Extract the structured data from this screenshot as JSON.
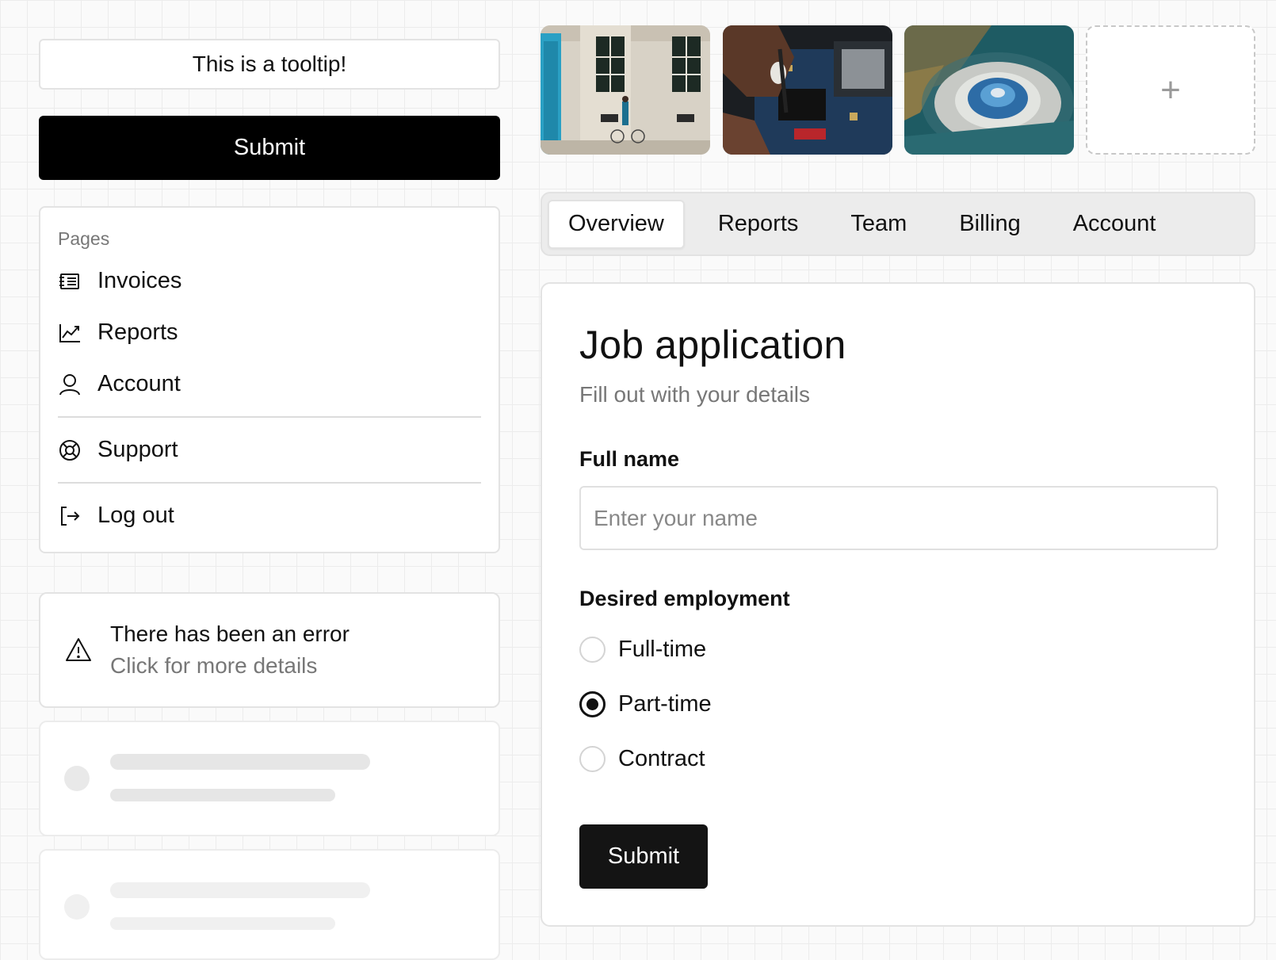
{
  "tooltip": {
    "text": "This is a tooltip!"
  },
  "top_submit": {
    "label": "Submit"
  },
  "menu": {
    "heading": "Pages",
    "items": [
      {
        "label": "Invoices",
        "icon": "invoice-icon"
      },
      {
        "label": "Reports",
        "icon": "chart-line-icon"
      },
      {
        "label": "Account",
        "icon": "user-icon"
      },
      {
        "label": "Support",
        "icon": "lifebuoy-icon"
      },
      {
        "label": "Log out",
        "icon": "logout-icon"
      }
    ]
  },
  "alert": {
    "title": "There has been an error",
    "description": "Click for more details",
    "icon": "warning-icon"
  },
  "gallery": {
    "images": [
      {
        "name": "building-photo"
      },
      {
        "name": "circuit-board-photo"
      },
      {
        "name": "aerial-dome-photo"
      }
    ],
    "add_icon": "plus-icon",
    "add_symbol": "+"
  },
  "tabs": {
    "items": [
      "Overview",
      "Reports",
      "Team",
      "Billing",
      "Account"
    ],
    "active": "Overview"
  },
  "form": {
    "title": "Job application",
    "subtitle": "Fill out with your details",
    "name_label": "Full name",
    "name_placeholder": "Enter your name",
    "name_value": "",
    "employment_label": "Desired employment",
    "options": [
      "Full-time",
      "Part-time",
      "Contract"
    ],
    "selected": "Part-time",
    "submit_label": "Submit"
  }
}
